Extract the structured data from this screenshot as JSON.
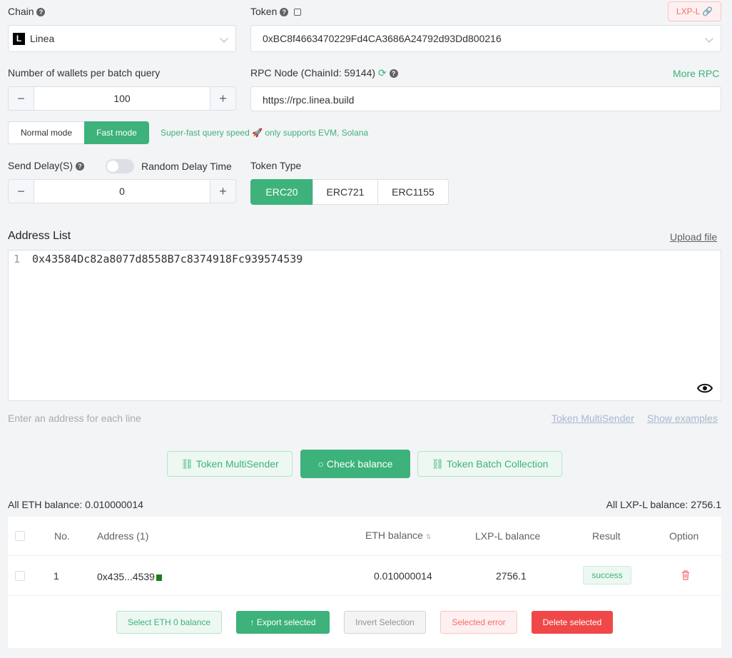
{
  "chain": {
    "label": "Chain",
    "value": "Linea",
    "logo": "L"
  },
  "token": {
    "label": "Token",
    "value": "0xBC8f4663470229Fd4CA3686A24792d93Dd800216",
    "badge": "LXP-L"
  },
  "wallets_per_batch": {
    "label": "Number of wallets per batch query",
    "value": "100",
    "minus": "−",
    "plus": "+"
  },
  "rpc": {
    "label": "RPC Node (ChainId: 59144)",
    "more": "More RPC",
    "value": "https://rpc.linea.build"
  },
  "mode": {
    "normal": "Normal mode",
    "fast": "Fast mode",
    "hint": "Super-fast query speed 🚀 only supports EVM, Solana"
  },
  "send_delay": {
    "label": "Send Delay(S)",
    "random_label": "Random Delay Time",
    "value": "0",
    "minus": "−",
    "plus": "+"
  },
  "token_type": {
    "label": "Token Type",
    "options": [
      "ERC20",
      "ERC721",
      "ERC1155"
    ],
    "selected": "ERC20"
  },
  "address_list": {
    "title": "Address List",
    "upload": "Upload file",
    "line_number": "1",
    "content": "0x43584Dc82a8077d8558B7c8374918Fc939574539",
    "placeholder": "Enter an address for each line",
    "multisender_link": "Token MultiSender",
    "examples_link": "Show examples"
  },
  "actions": {
    "multisender": "Token MultiSender",
    "check": "Check balance",
    "collection": "Token Batch Collection"
  },
  "summary": {
    "eth": "All ETH balance: 0.010000014",
    "token": "All LXP-L balance: 2756.1"
  },
  "table": {
    "headers": {
      "no": "No.",
      "address": "Address (1)",
      "eth": "ETH balance",
      "token": "LXP-L balance",
      "result": "Result",
      "option": "Option"
    },
    "rows": [
      {
        "no": "1",
        "address": "0x435...4539",
        "eth": "0.010000014",
        "token": "2756.1",
        "result": "success"
      }
    ]
  },
  "bottom_buttons": {
    "select_zero": "Select ETH 0 balance",
    "export": "Export selected",
    "invert": "Invert Selection",
    "error": "Selected error",
    "delete": "Delete selected"
  },
  "colors": {
    "accent": "#3db27b",
    "danger": "#f56c6c",
    "bg": "#f3f4f6"
  }
}
